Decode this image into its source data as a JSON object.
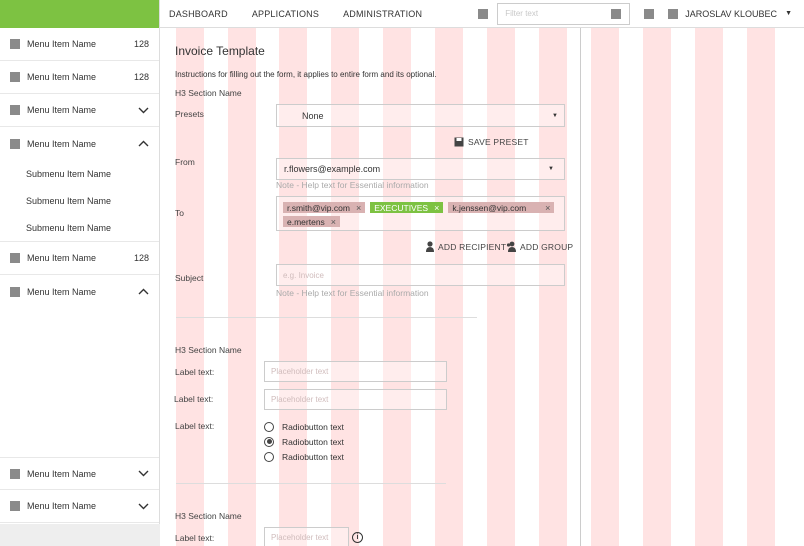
{
  "nav": {
    "links": [
      "DASHBOARD",
      "APPLICATIONS",
      "ADMINISTRATION"
    ],
    "filter_placeholder": "Filter text",
    "user_name": "JAROSLAV KLOUBEC"
  },
  "sidebar": {
    "items": [
      {
        "label": "Menu Item Name",
        "count": "128"
      },
      {
        "label": "Menu Item Name",
        "count": "128"
      },
      {
        "label": "Menu Item Name",
        "chevron": "down"
      },
      {
        "label": "Menu Item Name",
        "chevron": "up"
      },
      {
        "label": "Menu Item Name",
        "count": "128"
      },
      {
        "label": "Menu Item Name",
        "chevron": "up"
      },
      {
        "label": "Menu Item Name",
        "chevron": "down"
      },
      {
        "label": "Menu Item Name",
        "chevron": "down"
      }
    ],
    "submenu": [
      "Submenu Item Name",
      "Submenu Item Name",
      "Submenu Item Name"
    ]
  },
  "form": {
    "title": "Invoice Template",
    "instructions": "Instructions for filling out the form, it applies to entire form and its optional.",
    "section1": "H3 Section Name",
    "presets_label": "Presets",
    "presets_value": "None",
    "save_preset": "SAVE PRESET",
    "from_label": "From",
    "from_value": "r.flowers@example.com",
    "from_note": "Note - Help text for Essential information",
    "to_label": "To",
    "recipients": [
      {
        "text": "r.smith@vip.com",
        "x": "×"
      },
      {
        "text": "EXECUTIVES",
        "x": "×"
      },
      {
        "text": "k.jenssen@vip.com",
        "x": "×"
      },
      {
        "text": "e.mertens",
        "x": "×"
      }
    ],
    "add_recipient": "ADD RECIPIENT",
    "add_group": "ADD GROUP",
    "subject_label": "Subject",
    "subject_placeholder": "e.g. Invoice",
    "subject_note": "Note - Help text for Essential information",
    "section2": "H3 Section Name",
    "label_text_1": "Label text:",
    "placeholder_1": "Placeholder text",
    "label_text_2": "Label text:",
    "placeholder_2": "Placeholder text",
    "label_text_3": "Label text:",
    "radios": [
      "Radiobutton text",
      "Radiobutton text",
      "Radiobutton text"
    ],
    "radio_selected_index": 1,
    "section3": "H3 Section Name",
    "label_text_4": "Label text:",
    "placeholder_4": "Placeholder text",
    "info_glyph": "i"
  },
  "colors": {
    "brand_green": "#7dc242",
    "grid_column": "#ffe3e3",
    "chip": "#d9b2b2"
  }
}
